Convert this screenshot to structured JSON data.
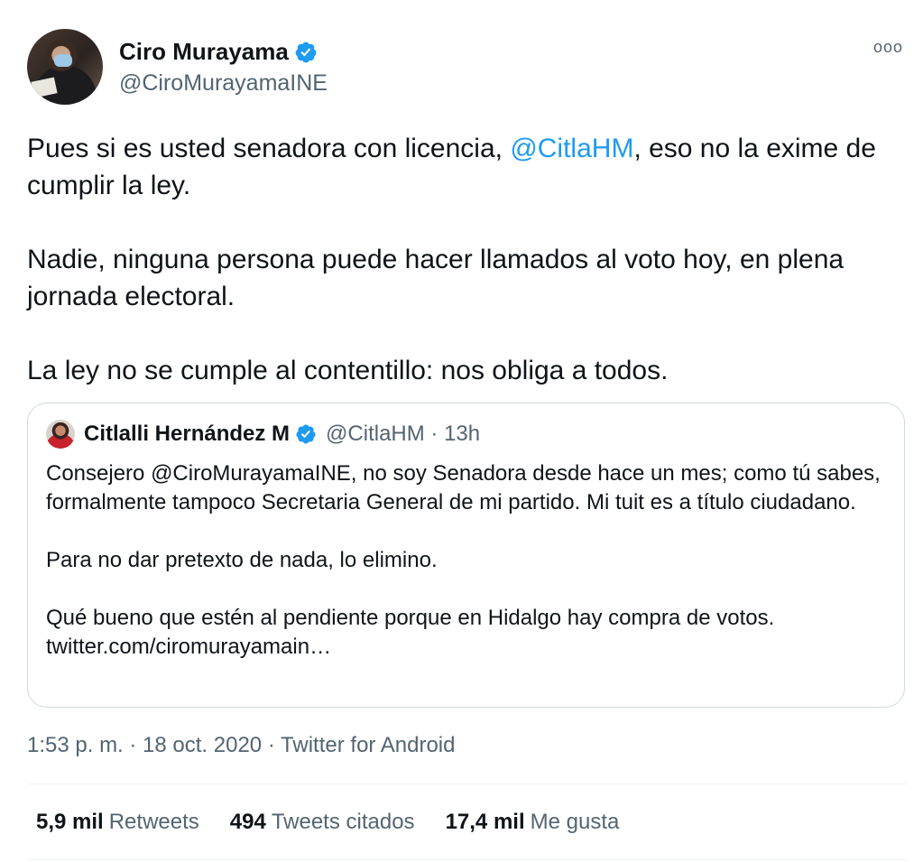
{
  "author": {
    "display_name": "Ciro Murayama",
    "handle": "@CiroMurayamaINE",
    "verified_icon": "verified-badge-icon",
    "more_icon": "more-options-icon",
    "more_glyph": "ooo"
  },
  "tweet": {
    "paragraphs": [
      {
        "before": "Pues si es usted senadora con licencia, ",
        "mention": "@CitlaHM",
        "after": ", eso no la exime de cumplir la ley."
      },
      {
        "text": "Nadie, ninguna persona puede hacer llamados al voto hoy, en plena jornada electoral."
      },
      {
        "text": "La ley no se cumple al contentillo: nos obliga a todos."
      }
    ]
  },
  "quoted": {
    "display_name": "Citlalli Hernández M",
    "meta": "@CitlaHM · 13h",
    "paragraphs": [
      "Consejero @CiroMurayamaINE, no soy Senadora desde hace un mes; como tú sabes, formalmente tampoco Secretaria General de mi partido. Mi tuit es a título ciudadano.",
      "Para no dar pretexto de nada, lo elimino.",
      "Qué bueno que estén al pendiente porque en Hidalgo hay compra de votos. twitter.com/ciromurayamain…"
    ]
  },
  "timestamp": "1:53 p. m. · 18 oct. 2020 · Twitter for Android",
  "stats": [
    {
      "count": "5,9 mil",
      "label": "Retweets"
    },
    {
      "count": "494",
      "label": "Tweets citados"
    },
    {
      "count": "17,4 mil",
      "label": "Me gusta"
    }
  ],
  "colors": {
    "accent": "#1d9bf0",
    "secondary_text": "#536471",
    "border": "#cfd9de"
  }
}
